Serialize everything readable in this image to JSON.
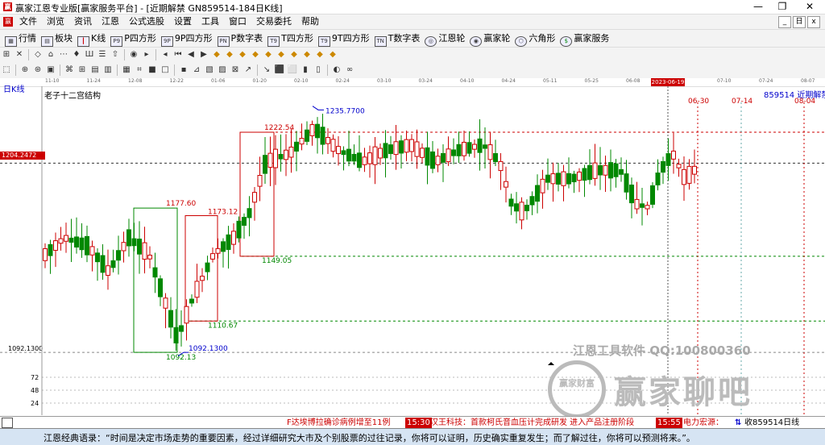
{
  "window": {
    "title": "赢家江恩专业版[赢家服务平台] - [近期解禁  GN859514-184日K线]",
    "minimize": "—",
    "maximize": "❐",
    "close": "✕"
  },
  "menu": [
    "文件",
    "浏览",
    "资讯",
    "江恩",
    "公式选股",
    "设置",
    "工具",
    "窗口",
    "交易委托",
    "帮助"
  ],
  "menu_right_buttons": [
    "_",
    "日",
    "x"
  ],
  "toolbar1": [
    {
      "label": "行情",
      "icon": "grid-icon"
    },
    {
      "label": "板块",
      "icon": "blocks-icon"
    },
    {
      "label": "K线",
      "icon": "candle-icon"
    },
    {
      "label": "P四方形",
      "icon": "p-square-icon",
      "code": "P9"
    },
    {
      "label": "9P四方形",
      "icon": "9p-square-icon",
      "code": "9P"
    },
    {
      "label": "P数字表",
      "icon": "p-table-icon",
      "code": "PN"
    },
    {
      "label": "T四方形",
      "icon": "t-square-icon",
      "code": "T9"
    },
    {
      "label": "9T四方形",
      "icon": "9t-square-icon",
      "code": "T9"
    },
    {
      "label": "T数字表",
      "icon": "t-table-icon",
      "code": "TN"
    },
    {
      "label": "江恩轮",
      "icon": "gann-wheel-icon"
    },
    {
      "label": "赢家轮",
      "icon": "winner-wheel-icon"
    },
    {
      "label": "六角形",
      "icon": "hexagon-icon"
    },
    {
      "label": "赢家服务",
      "icon": "service-icon"
    }
  ],
  "chart_panel": {
    "period": "日K线",
    "overlay_name": "老子十二宫结构",
    "right_label": "859514  近期解禁",
    "current_price_badge": "1204.2472",
    "selected_date": "2023-06-19"
  },
  "date_axis": [
    "11-10",
    "11-24",
    "12-08",
    "12-22",
    "01-06",
    "01-20",
    "02-10",
    "02-24",
    "03-10",
    "03-24",
    "04-10",
    "04-24",
    "05-11",
    "05-25",
    "06-08",
    "07-10",
    "07-24",
    "08-07"
  ],
  "chart_data": {
    "type": "candlestick",
    "price_levels": [
      {
        "label": "1222.54",
        "value": 1222.54,
        "color": "#c00"
      },
      {
        "label": "1235.7700",
        "value": 1235.77,
        "color": "#00c"
      },
      {
        "label": "1177.60",
        "value": 1177.6,
        "color": "#c00"
      },
      {
        "label": "1173.12",
        "value": 1173.12,
        "color": "#c00"
      },
      {
        "label": "1149.05",
        "value": 1149.05,
        "color": "#080"
      },
      {
        "label": "1110.67",
        "value": 1110.67,
        "color": "#080"
      },
      {
        "label": "1092.1300",
        "value": 1092.13,
        "color": "#00c"
      },
      {
        "label": "1092.13",
        "value": 1092.13,
        "color": "#080"
      }
    ],
    "future_dates": [
      "06-30",
      "07-14",
      "08-04"
    ],
    "y_axis_label": "1092.1300",
    "volume_ticks": [
      "72",
      "48",
      "24"
    ],
    "ylim": [
      1085,
      1245
    ],
    "up_color": "#c00",
    "down_color": "#080"
  },
  "watermark": {
    "line1": "江恩工具软件  QQ:100800360",
    "line2": "赢家聊吧",
    "seal": "赢家财富"
  },
  "status": {
    "news1": "F达埃博拉确诊病例增至11例",
    "time1": "15:30",
    "news2": "汉王科技：首款柯氏音血压计完成研发 进入产品注册阶段",
    "time2": "15:55",
    "news3": "电力宏源：",
    "right": "收859514日线"
  },
  "quote": "江恩经典语录：“时间是决定市场走势的重要因素，经过详细研究大市及个别股票的过往记录，你将可以证明，历史确实重复发生；而了解过往，你将可以预测将来。”。"
}
